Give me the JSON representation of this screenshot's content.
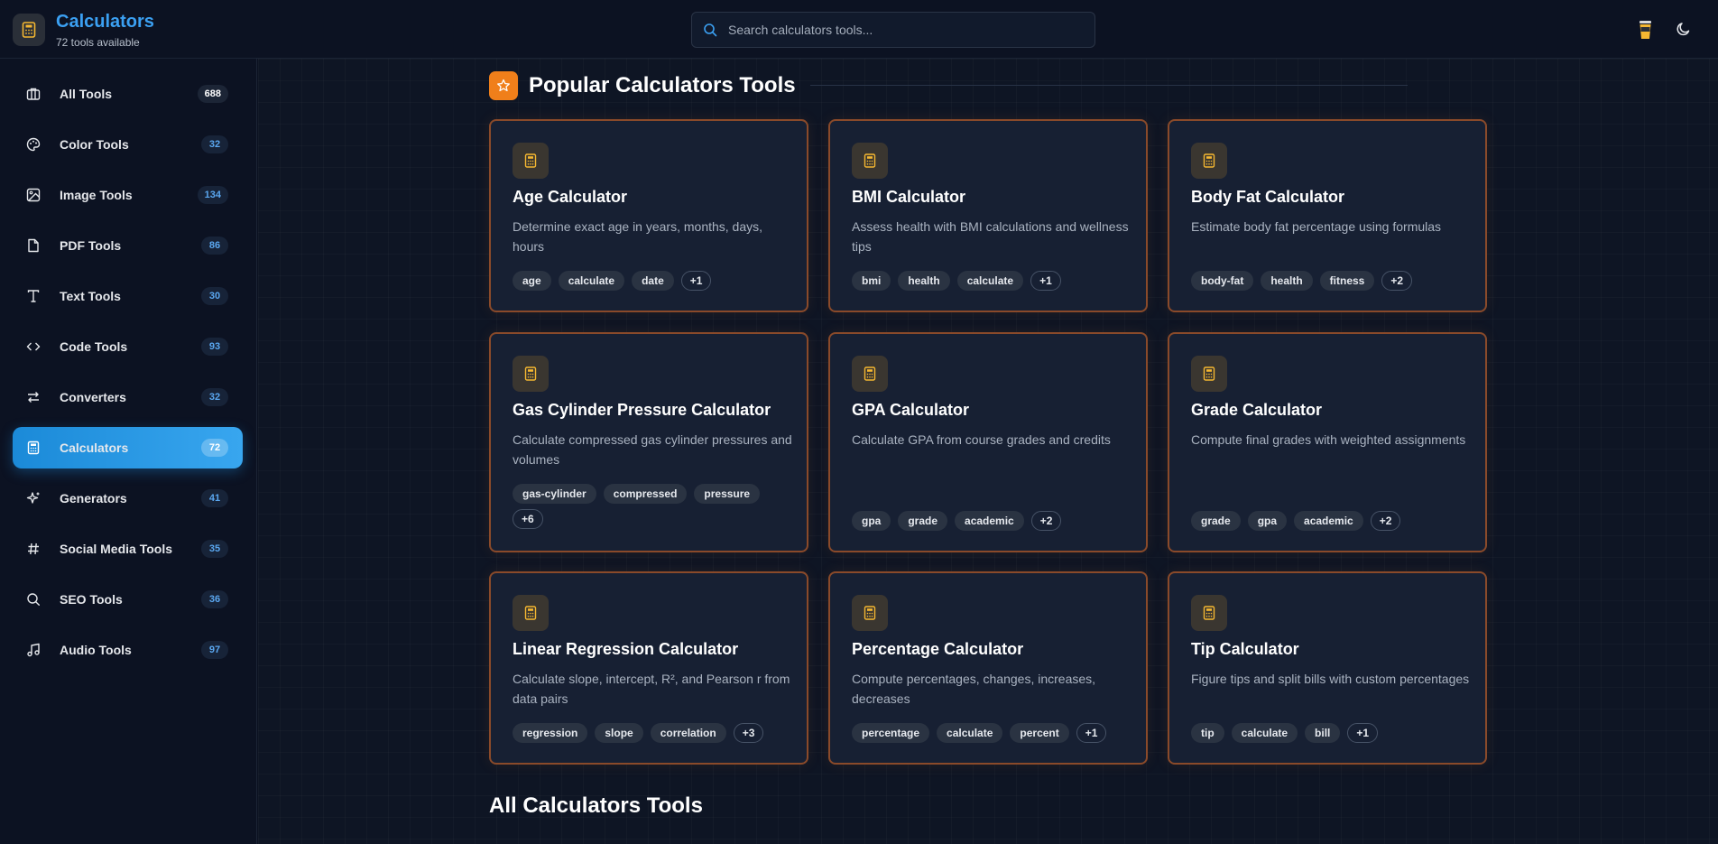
{
  "brand": {
    "title": "Calculators",
    "subtitle": "72 tools available"
  },
  "search": {
    "placeholder": "Search calculators tools..."
  },
  "sidebar": {
    "items": [
      {
        "label": "All Tools",
        "count": "688",
        "icon": "grid-icon"
      },
      {
        "label": "Color Tools",
        "count": "32",
        "icon": "palette-icon"
      },
      {
        "label": "Image Tools",
        "count": "134",
        "icon": "image-icon"
      },
      {
        "label": "PDF Tools",
        "count": "86",
        "icon": "file-icon"
      },
      {
        "label": "Text Tools",
        "count": "30",
        "icon": "type-icon"
      },
      {
        "label": "Code Tools",
        "count": "93",
        "icon": "code-icon"
      },
      {
        "label": "Converters",
        "count": "32",
        "icon": "arrows-icon"
      },
      {
        "label": "Calculators",
        "count": "72",
        "icon": "calculator-icon",
        "active": true
      },
      {
        "label": "Generators",
        "count": "41",
        "icon": "sparkles-icon"
      },
      {
        "label": "Social Media Tools",
        "count": "35",
        "icon": "hash-icon"
      },
      {
        "label": "SEO Tools",
        "count": "36",
        "icon": "search-icon"
      },
      {
        "label": "Audio Tools",
        "count": "97",
        "icon": "music-icon"
      }
    ]
  },
  "main": {
    "popular_title": "Popular Calculators Tools",
    "all_title": "All Calculators Tools",
    "cards": [
      {
        "title": "Age Calculator",
        "desc": "Determine exact age in years, months, days, hours",
        "tags": [
          "age",
          "calculate",
          "date"
        ],
        "more": "+1"
      },
      {
        "title": "BMI Calculator",
        "desc": "Assess health with BMI calculations and wellness tips",
        "tags": [
          "bmi",
          "health",
          "calculate"
        ],
        "more": "+1"
      },
      {
        "title": "Body Fat Calculator",
        "desc": "Estimate body fat percentage using formulas",
        "tags": [
          "body-fat",
          "health",
          "fitness"
        ],
        "more": "+2"
      },
      {
        "title": "Gas Cylinder Pressure Calculator",
        "desc": "Calculate compressed gas cylinder pressures and volumes",
        "tags": [
          "gas-cylinder",
          "compressed",
          "pressure"
        ],
        "more": "+6"
      },
      {
        "title": "GPA Calculator",
        "desc": "Calculate GPA from course grades and credits",
        "tags": [
          "gpa",
          "grade",
          "academic"
        ],
        "more": "+2"
      },
      {
        "title": "Grade Calculator",
        "desc": "Compute final grades with weighted assignments",
        "tags": [
          "grade",
          "gpa",
          "academic"
        ],
        "more": "+2"
      },
      {
        "title": "Linear Regression Calculator",
        "desc": "Calculate slope, intercept, R², and Pearson r from data pairs",
        "tags": [
          "regression",
          "slope",
          "correlation"
        ],
        "more": "+3"
      },
      {
        "title": "Percentage Calculator",
        "desc": "Compute percentages, changes, increases, decreases",
        "tags": [
          "percentage",
          "calculate",
          "percent"
        ],
        "more": "+1"
      },
      {
        "title": "Tip Calculator",
        "desc": "Figure tips and split bills with custom percentages",
        "tags": [
          "tip",
          "calculate",
          "bill"
        ],
        "more": "+1"
      }
    ]
  },
  "colors": {
    "accent": "#1b8ad8",
    "brand": "#3ba0f2",
    "card_border": "#8a4a2a",
    "section_icon": "#f07f1a",
    "calc_icon": "#f5b731"
  }
}
